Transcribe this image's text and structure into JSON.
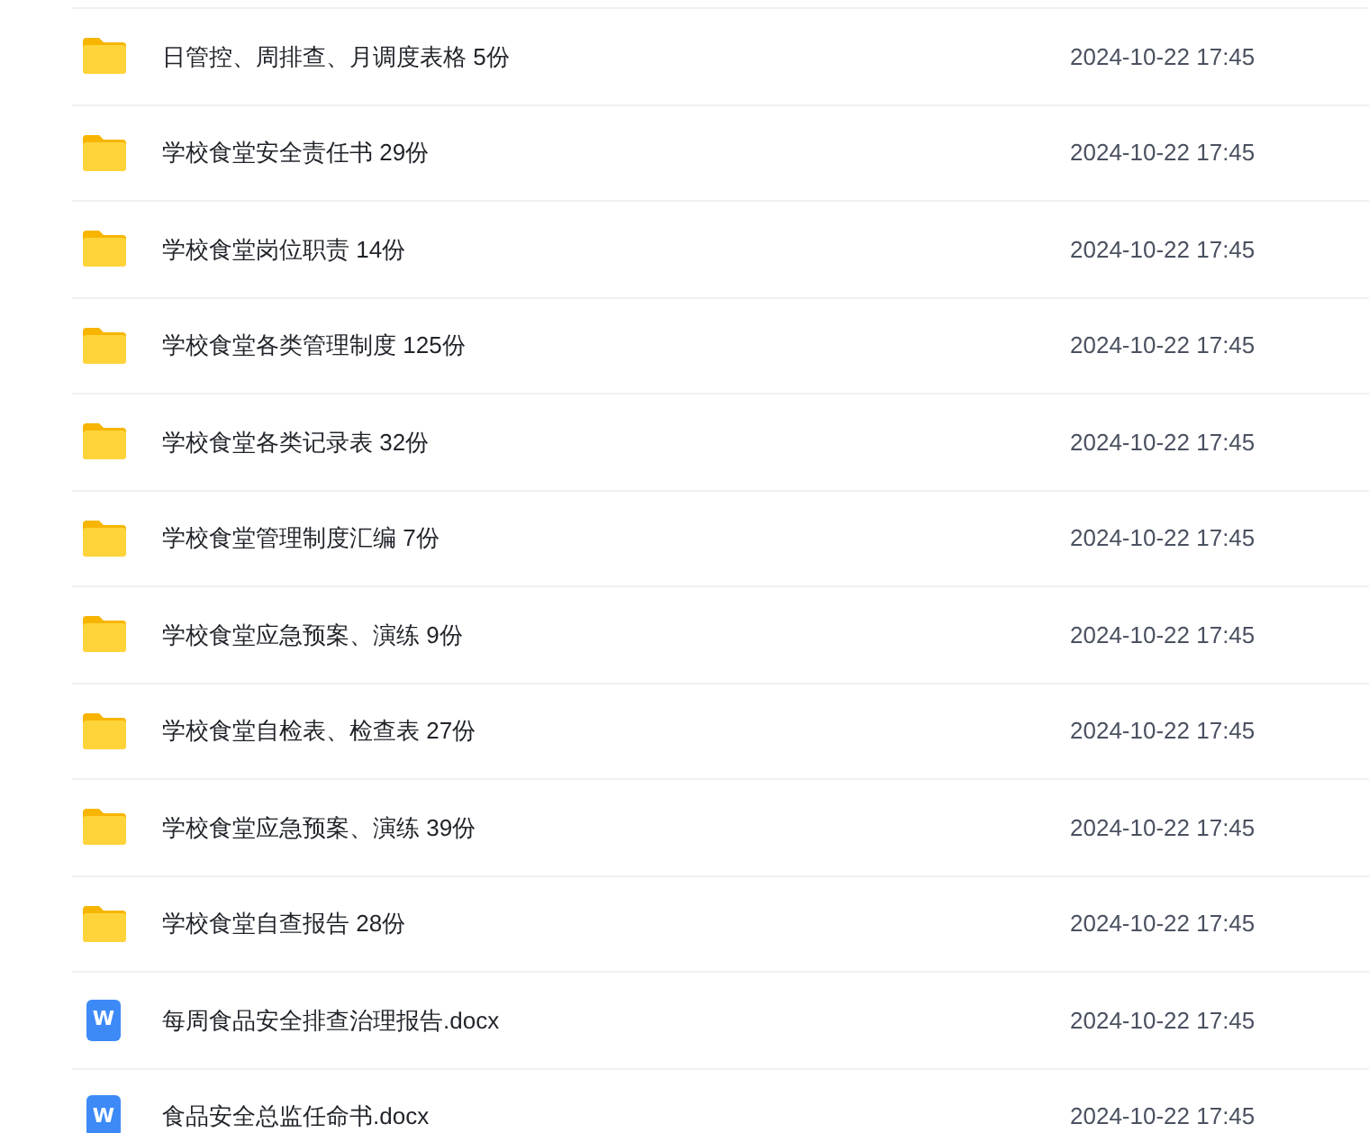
{
  "files": [
    {
      "kind": "folder",
      "name": "日管控、周排查、月调度表格 5份",
      "modified": "2024-10-22 17:45"
    },
    {
      "kind": "folder",
      "name": "学校食堂安全责任书 29份",
      "modified": "2024-10-22 17:45"
    },
    {
      "kind": "folder",
      "name": "学校食堂岗位职责 14份",
      "modified": "2024-10-22 17:45"
    },
    {
      "kind": "folder",
      "name": "学校食堂各类管理制度 125份",
      "modified": "2024-10-22 17:45"
    },
    {
      "kind": "folder",
      "name": "学校食堂各类记录表 32份",
      "modified": "2024-10-22 17:45"
    },
    {
      "kind": "folder",
      "name": "学校食堂管理制度汇编 7份",
      "modified": "2024-10-22 17:45"
    },
    {
      "kind": "folder",
      "name": "学校食堂应急预案、演练 9份",
      "modified": "2024-10-22 17:45"
    },
    {
      "kind": "folder",
      "name": "学校食堂自检表、检查表 27份",
      "modified": "2024-10-22 17:45"
    },
    {
      "kind": "folder",
      "name": "学校食堂应急预案、演练 39份",
      "modified": "2024-10-22 17:45"
    },
    {
      "kind": "folder",
      "name": "学校食堂自查报告 28份",
      "modified": "2024-10-22 17:45"
    },
    {
      "kind": "doc",
      "icon_letter": "W",
      "name": "每周食品安全排查治理报告.docx",
      "modified": "2024-10-22 17:45"
    },
    {
      "kind": "doc",
      "icon_letter": "W",
      "name": "食品安全总监任命书.docx",
      "modified": "2024-10-22 17:45"
    }
  ]
}
